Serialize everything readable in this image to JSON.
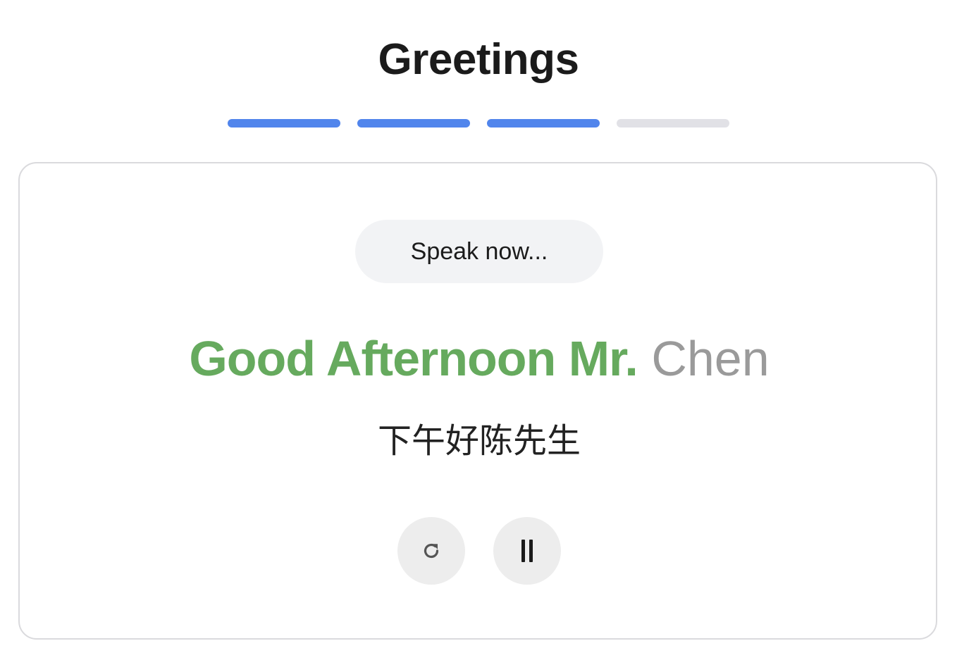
{
  "header": {
    "title": "Greetings"
  },
  "progress": {
    "total_steps": 4,
    "completed_steps": 3,
    "active_color": "#5185ec",
    "inactive_color": "#e1e1e6"
  },
  "card": {
    "status_label": "Speak now...",
    "phrase": {
      "spoken_text": "Good Afternoon Mr.",
      "pending_text": "Chen",
      "spoken_color": "#66aa5e",
      "pending_color": "#9a9a9a"
    },
    "translation": "下午好陈先生",
    "controls": {
      "retry_icon": "refresh-icon",
      "pause_icon": "pause-icon"
    }
  }
}
